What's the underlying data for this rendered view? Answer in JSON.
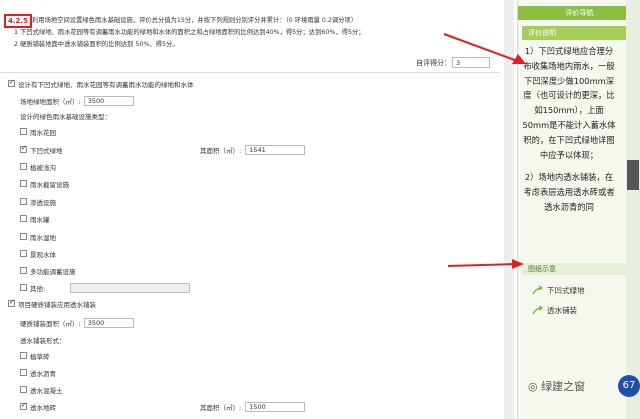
{
  "header": {
    "code": "4.2.5",
    "line1": "利用场地空间设置绿色雨水基础设施，评价总分值为15分，并按下列规则分别评分并累计：（0 环境雨量 0.2调分项）",
    "line2": "1  下凹式绿地、雨水花园等有调蓄雨水功能的绿地和水体的面积之和占绿地面积的比例达到40%，得5分；达到60%，得5分；",
    "line3": "2  硬质铺装地面中透水铺装面积的比例达到 50%，得5分。"
  },
  "self_score": {
    "label": "自评得分：",
    "value": "3"
  },
  "section1": {
    "title": "设计有下凹式绿地、雨水花园等有调蓄雨水功能的绿地和水体",
    "area_label": "场地绿地面积（㎡）:",
    "area_value": "3500",
    "type_label": "设计的绿色雨水基础设施类型：",
    "items": [
      {
        "label": "雨水花园",
        "checked": false
      },
      {
        "label": "下凹式绿地",
        "checked": true,
        "area_label": "其面积（㎡）:",
        "area_value": "1541"
      },
      {
        "label": "植被浅沟",
        "checked": false
      },
      {
        "label": "雨水截留设施",
        "checked": false
      },
      {
        "label": "渗透设施",
        "checked": false
      },
      {
        "label": "雨水罐",
        "checked": false
      },
      {
        "label": "雨水湿地",
        "checked": false
      },
      {
        "label": "景观水体",
        "checked": false
      },
      {
        "label": "多功能调蓄设施",
        "checked": false
      },
      {
        "label": "其他:",
        "checked": false
      }
    ]
  },
  "section2": {
    "title": "项目硬质铺装应用透水铺装",
    "area_label": "硬质铺装面积（㎡）:",
    "area_value": "3500",
    "form_label": "透水铺装形式：",
    "items": [
      {
        "label": "植草砖",
        "checked": false
      },
      {
        "label": "透水沥青",
        "checked": false
      },
      {
        "label": "透水混凝土",
        "checked": false
      },
      {
        "label": "透水地砖",
        "checked": true,
        "area_label": "其面积（㎡）:",
        "area_value": "1500"
      }
    ]
  },
  "sidebar": {
    "nav_title": "评价导航",
    "sub_title": "评价说明",
    "explanation_1": "1）下凹式绿地应合理分布收集场地内雨水，一般下凹深度少做100mm深度（也可设计的更深，比如150mm），上面50mm是不能计入蓄水体积的，在下凹式绿地详图中应予以体现；",
    "explanation_2": "2）场地内透水铺装，在考虑表层选用透水砖或者透水沥青的同",
    "pic_title": "图纸示意",
    "pic_items": [
      "下凹式绿地",
      "透水铺装"
    ]
  },
  "watermark": "绿建之窗",
  "badge": "67",
  "colors": {
    "accent": "#8bbf44",
    "arrow": "#e02020",
    "highlight": "#e02020"
  }
}
